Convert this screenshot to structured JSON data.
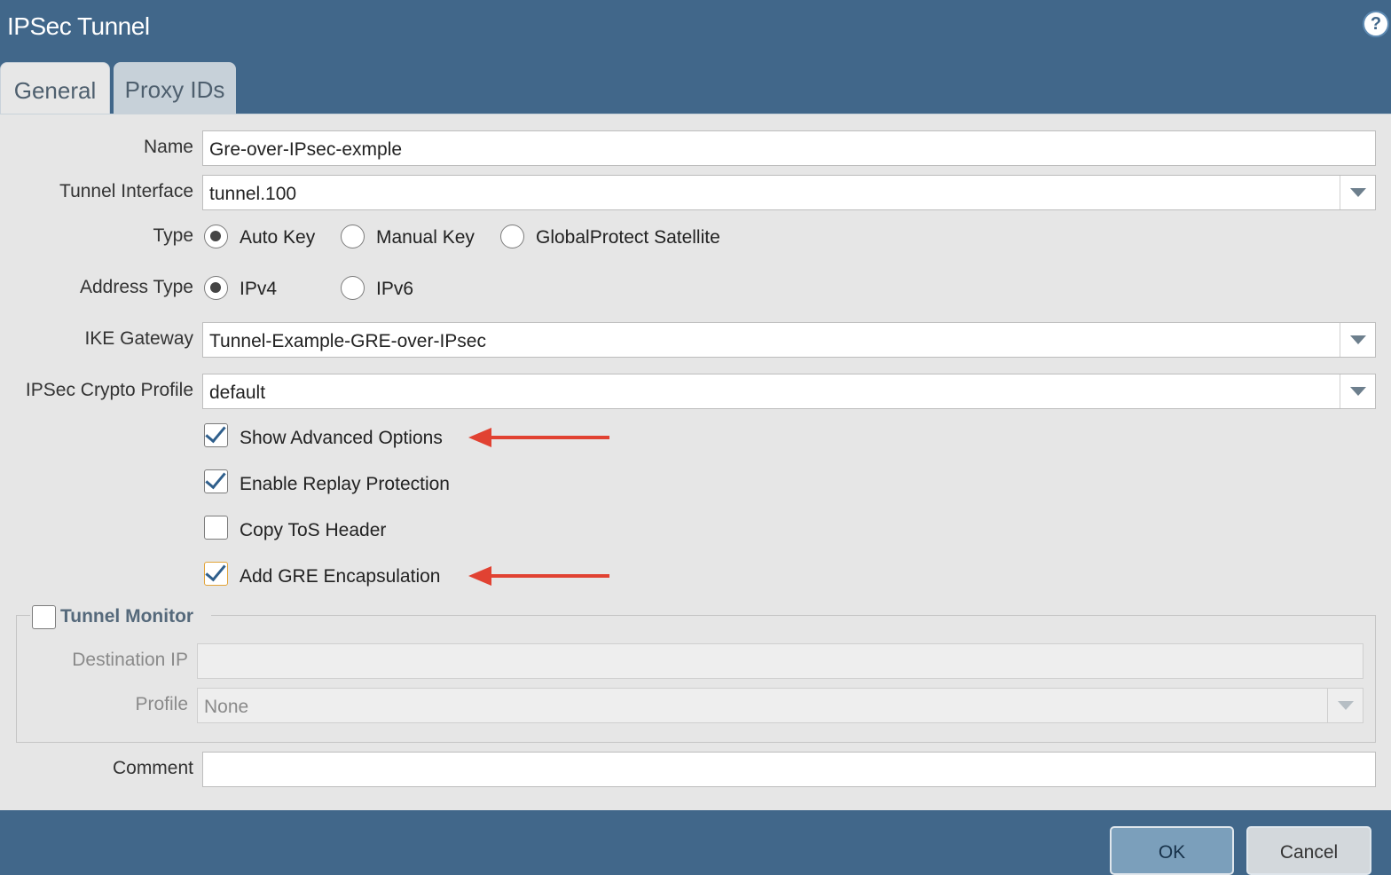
{
  "dialog": {
    "title": "IPSec Tunnel",
    "help_icon": "help-icon"
  },
  "tabs": [
    {
      "label": "General",
      "active": true
    },
    {
      "label": "Proxy IDs",
      "active": false
    }
  ],
  "form": {
    "name": {
      "label": "Name",
      "value": "Gre-over-IPsec-exmple"
    },
    "tunnel_interface": {
      "label": "Tunnel Interface",
      "value": "tunnel.100"
    },
    "type": {
      "label": "Type",
      "options": [
        {
          "label": "Auto Key",
          "selected": true
        },
        {
          "label": "Manual Key",
          "selected": false
        },
        {
          "label": "GlobalProtect Satellite",
          "selected": false
        }
      ]
    },
    "address_type": {
      "label": "Address Type",
      "options": [
        {
          "label": "IPv4",
          "selected": true
        },
        {
          "label": "IPv6",
          "selected": false
        }
      ]
    },
    "ike_gateway": {
      "label": "IKE Gateway",
      "value": "Tunnel-Example-GRE-over-IPsec"
    },
    "ipsec_crypto_profile": {
      "label": "IPSec Crypto Profile",
      "value": "default"
    },
    "checkboxes": [
      {
        "label": "Show Advanced Options",
        "checked": true,
        "annotated": true
      },
      {
        "label": "Enable Replay Protection",
        "checked": true,
        "annotated": false
      },
      {
        "label": "Copy ToS Header",
        "checked": false,
        "annotated": false
      },
      {
        "label": "Add GRE Encapsulation",
        "checked": true,
        "annotated": true
      }
    ],
    "tunnel_monitor": {
      "label": "Tunnel Monitor",
      "checked": false,
      "destination_ip": {
        "label": "Destination IP",
        "value": ""
      },
      "profile": {
        "label": "Profile",
        "value": "None"
      }
    },
    "comment": {
      "label": "Comment",
      "value": ""
    }
  },
  "buttons": {
    "ok": "OK",
    "cancel": "Cancel"
  },
  "colors": {
    "header": "#41678a",
    "panel": "#e6e6e6",
    "annotation_arrow": "#e14232"
  }
}
